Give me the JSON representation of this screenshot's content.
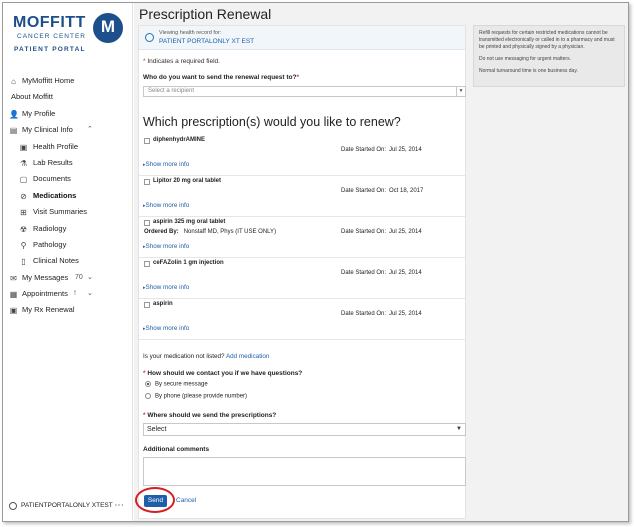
{
  "brand": {
    "name": "MOFFITT",
    "sub": "CANCER CENTER",
    "portal": "PATIENT PORTAL"
  },
  "sidebar": {
    "items": [
      {
        "label": "MyMoffitt Home",
        "icon": "home-icon"
      },
      {
        "label": "About Moffitt",
        "icon": ""
      },
      {
        "label": "My Profile",
        "icon": "user-icon"
      },
      {
        "label": "My Clinical Info",
        "icon": "clinical-icon",
        "expanded": true
      },
      {
        "label": "Health Profile",
        "icon": "health-profile-icon"
      },
      {
        "label": "Lab Results",
        "icon": "lab-icon"
      },
      {
        "label": "Documents",
        "icon": "document-icon"
      },
      {
        "label": "Medications",
        "icon": "medication-icon",
        "active": true
      },
      {
        "label": "Visit Summaries",
        "icon": "visit-icon"
      },
      {
        "label": "Radiology",
        "icon": "radiology-icon"
      },
      {
        "label": "Pathology",
        "icon": "pathology-icon"
      },
      {
        "label": "Clinical Notes",
        "icon": "notes-icon"
      },
      {
        "label": "My Messages",
        "icon": "mail-icon",
        "badge": "70"
      },
      {
        "label": "Appointments",
        "icon": "calendar-icon"
      },
      {
        "label": "My Rx Renewal",
        "icon": "rx-icon"
      }
    ],
    "user": "PATIENTPORTALONLY XTEST",
    "user_more": "···"
  },
  "page": {
    "title": "Prescription Renewal",
    "viewing_label": "Viewing health record for:",
    "viewing_name": "PATIENT PORTALONLY XT EST",
    "required_note": "Indicates a required field.",
    "recipient_question": "Who do you want to send the renewal request to?",
    "recipient_placeholder": "Select a recipient",
    "rx_heading": "Which prescription(s) would you like to renew?",
    "date_label": "Date Started On:",
    "show_more": "Show more info",
    "prescriptions": [
      {
        "name": "diphenhydrAMINE",
        "ordered_by_label": "",
        "ordered_by": "",
        "date": "Jul 25, 2014"
      },
      {
        "name": "Lipitor 20 mg oral tablet",
        "ordered_by_label": "",
        "ordered_by": "",
        "date": "Oct 18, 2017"
      },
      {
        "name": "aspirin 325 mg oral tablet",
        "ordered_by_label": "Ordered By:",
        "ordered_by": "Nonstaff MD, Phys (IT USE ONLY)",
        "date": "Jul 25, 2014"
      },
      {
        "name": "ceFAZolin 1 gm injection",
        "ordered_by_label": "",
        "ordered_by": "",
        "date": "Jul 25, 2014"
      },
      {
        "name": "aspirin",
        "ordered_by_label": "",
        "ordered_by": "",
        "date": "Jul 25, 2014"
      }
    ],
    "not_listed_text": "Is your medication not listed?",
    "add_medication": "Add medication",
    "contact_question": "How should we contact you if we have questions?",
    "contact_options": [
      {
        "label": "By secure message",
        "selected": true
      },
      {
        "label": "By phone (please provide number)",
        "selected": false
      }
    ],
    "send_where_question": "Where should we send the prescriptions?",
    "send_where_value": "Select",
    "comments_label": "Additional comments",
    "send_label": "Send",
    "cancel_label": "Cancel"
  },
  "notice": {
    "lines": [
      "Refill requests for certain restricted medications cannot be transmitted electronically or called in to a pharmacy and must be printed and physically signed by a physician.",
      "Do not use messaging for urgent matters.",
      "Normal turnaround time is one business day."
    ]
  },
  "colors": {
    "brand_blue": "#1d4f8c",
    "link_blue": "#1d5fa8",
    "button_blue": "#1f5fa8",
    "highlight_red": "#d32020"
  }
}
